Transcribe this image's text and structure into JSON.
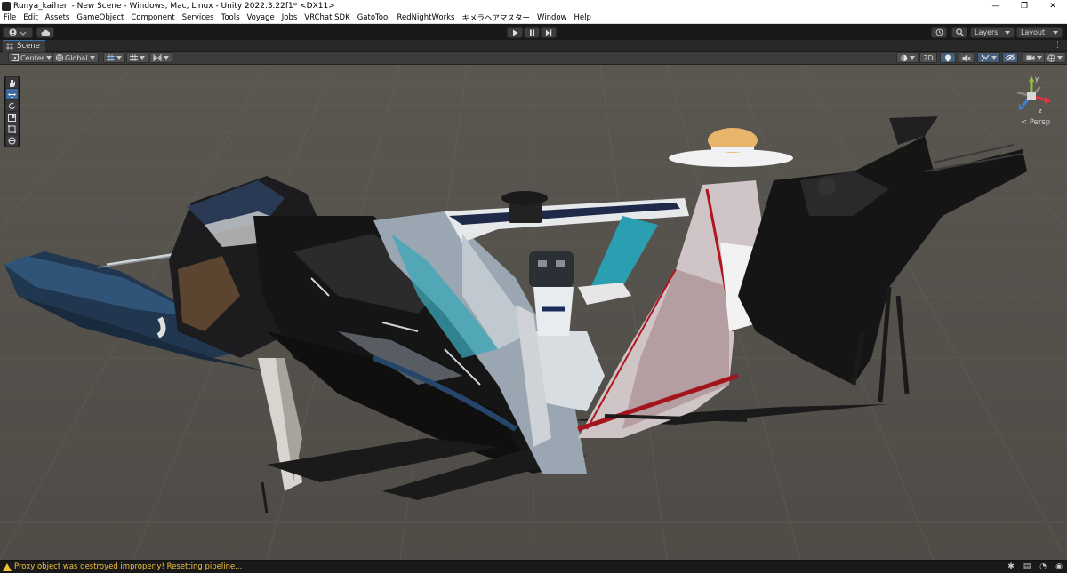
{
  "window": {
    "title": "Runya_kaihen - New Scene - Windows, Mac, Linux - Unity 2022.3.22f1* <DX11>",
    "minimize": "—",
    "maximize": "❐",
    "close": "✕"
  },
  "menu": [
    "File",
    "Edit",
    "Assets",
    "GameObject",
    "Component",
    "Services",
    "Tools",
    "Voyage",
    "Jobs",
    "VRChat SDK",
    "GatoTool",
    "RedNightWorks",
    "キメラヘアマスター",
    "Window",
    "Help"
  ],
  "toolbar": {
    "layers_label": "Layers",
    "layout_label": "Layout"
  },
  "scene_tab": {
    "label": "Scene"
  },
  "scene_toolbar": {
    "pivot_label": "Center",
    "space_label": "Global",
    "mode_2d_label": "2D"
  },
  "viewport": {
    "projection_label": "< Persp",
    "gizmo_y": "y",
    "gizmo_z": "z"
  },
  "status": {
    "message": "Proxy object was destroyed improperly! Resetting pipeline..."
  }
}
